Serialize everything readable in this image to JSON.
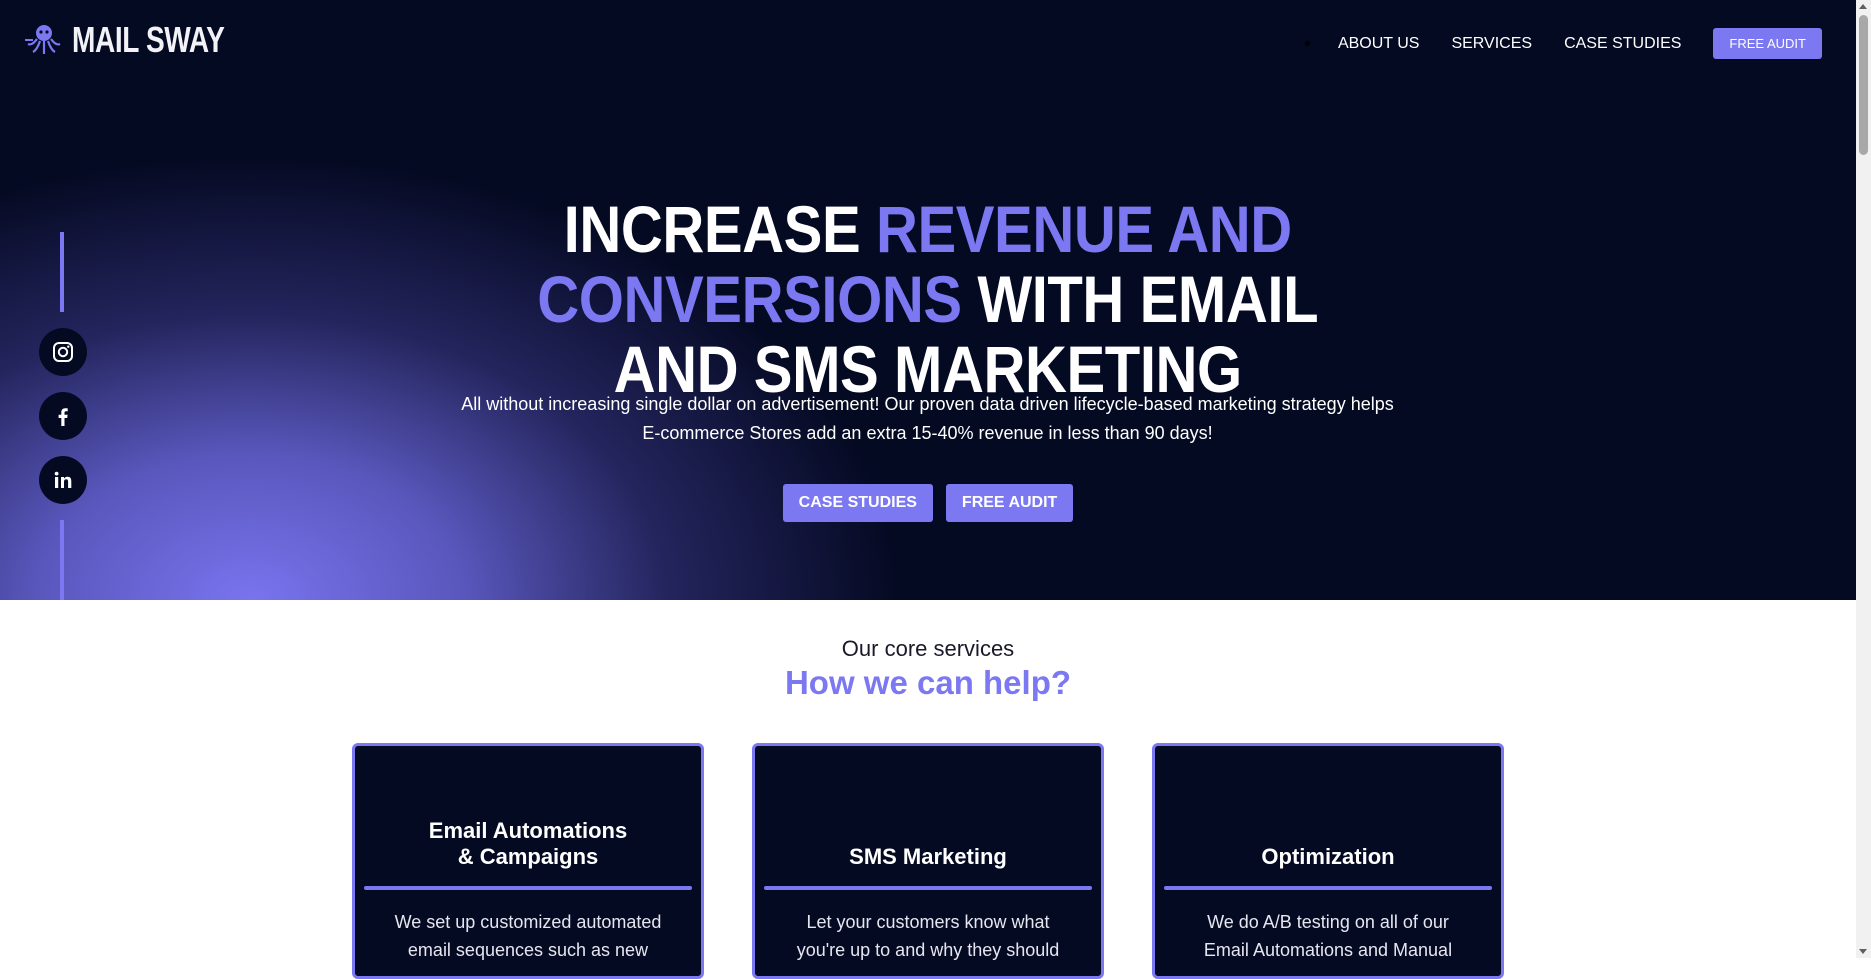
{
  "brand": {
    "name": "MAIL SWAY",
    "logo_icon": "octopus-icon",
    "accent": "#7b78f2",
    "dark": "#050a23"
  },
  "nav": {
    "items": [
      "ABOUT US",
      "SERVICES",
      "CASE STUDIES"
    ],
    "cta_label": "FREE AUDIT"
  },
  "hero": {
    "headline_part1": "INCREASE ",
    "headline_accent1": "REVENUE AND",
    "headline_accent2": "CONVERSIONS",
    "headline_part2": " WITH EMAIL",
    "headline_part3": "AND SMS MARKETING",
    "subtext": "All without increasing single dollar on advertisement! Our proven data driven lifecycle-based marketing strategy helps E-commerce Stores add an extra 15-40% revenue in less than 90 days!",
    "cta_case_studies": "CASE STUDIES",
    "cta_free_audit": "FREE AUDIT"
  },
  "social": [
    "instagram-icon",
    "facebook-icon",
    "linkedin-icon"
  ],
  "services": {
    "kicker": "Our core services",
    "title": "How we can help?",
    "cards": [
      {
        "title_line1": "Email Automations",
        "title_line2": "& Campaigns",
        "text": "We set up customized automated email sequences such as new"
      },
      {
        "title_line1": "SMS Marketing",
        "title_line2": "",
        "text": "Let your customers know what you're up to and why they should"
      },
      {
        "title_line1": "Optimization",
        "title_line2": "",
        "text": "We do A/B testing on all of our Email Automations and Manual"
      }
    ]
  }
}
